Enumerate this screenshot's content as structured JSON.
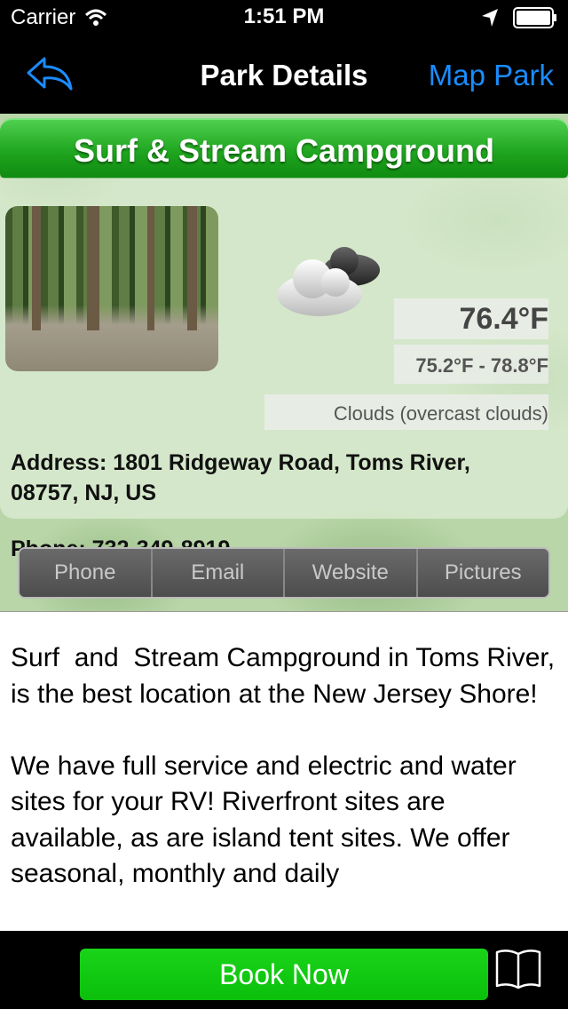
{
  "status_bar": {
    "carrier": "Carrier",
    "time": "1:51 PM",
    "icons": [
      "wifi-icon",
      "location-arrow-icon",
      "battery-icon"
    ]
  },
  "nav": {
    "back_icon": "back-reply-arrow-icon",
    "title": "Park Details",
    "right_label": "Map Park",
    "accent": "#1a8cff"
  },
  "park": {
    "name": "Surf & Stream Campground",
    "photo": "campground-forest-photo",
    "address": "Address: 1801 Ridgeway Road, Toms River, 08757, NJ, US",
    "phone": "Phone: 732-349-8919"
  },
  "weather": {
    "icon": "cloud-overcast-icon",
    "temperature": "76.4°F",
    "range": "75.2°F - 78.8°F",
    "condition": "Clouds (overcast clouds)"
  },
  "segments": [
    "Phone",
    "Email",
    "Website",
    "Pictures"
  ],
  "description": "Surf  and  Stream Campground in Toms River, is the best location at the New Jersey Shore!\n\nWe have full service and electric and water sites for your RV! Riverfront sites are available, as are island tent sites. We offer seasonal, monthly and daily",
  "bottom": {
    "book_label": "Book Now",
    "book_color": "#0bbf0b",
    "book_icon": "open-book-icon"
  }
}
